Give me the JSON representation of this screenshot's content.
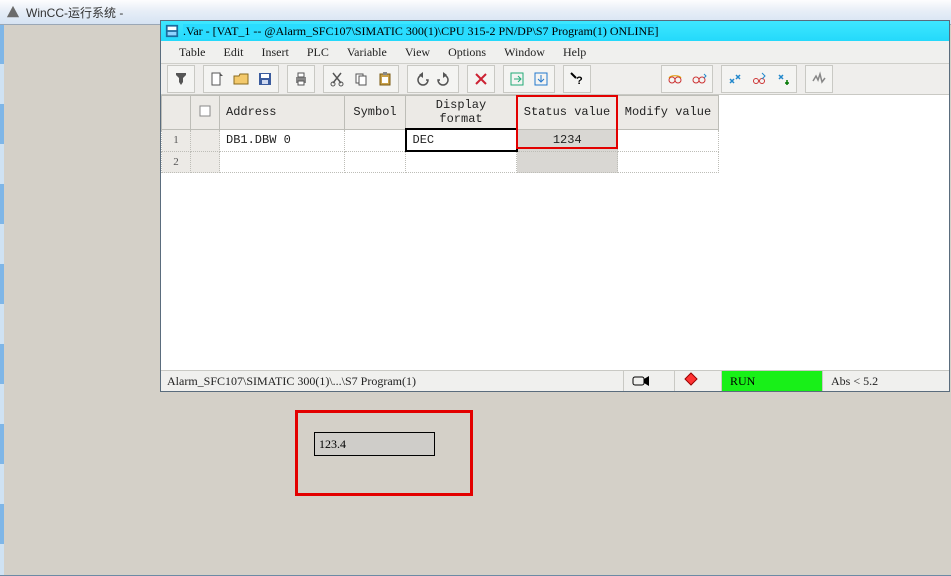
{
  "wincc": {
    "title": "WinCC-运行系统 -"
  },
  "var_window": {
    "title": ".Var - [VAT_1 -- @Alarm_SFC107\\SIMATIC 300(1)\\CPU 315-2 PN/DP\\S7 Program(1)  ONLINE]"
  },
  "menu": {
    "table": "Table",
    "edit": "Edit",
    "insert": "Insert",
    "plc": "PLC",
    "variable": "Variable",
    "view": "View",
    "options": "Options",
    "window": "Window",
    "help": "Help"
  },
  "grid": {
    "headers": {
      "address": "Address",
      "symbol": "Symbol",
      "display_format": "Display format",
      "status_value": "Status value",
      "modify_value": "Modify value"
    },
    "rows": [
      {
        "n": "1",
        "address": "DB1.DBW    0",
        "symbol": "",
        "display_format": "DEC",
        "status_value": "1234",
        "modify_value": ""
      },
      {
        "n": "2",
        "address": "",
        "symbol": "",
        "display_format": "",
        "status_value": "",
        "modify_value": ""
      }
    ]
  },
  "statusbar": {
    "path": "Alarm_SFC107\\SIMATIC 300(1)\\...\\S7 Program(1)",
    "run": "RUN",
    "abs": "Abs < 5.2"
  },
  "io_field": {
    "value": "123.4"
  }
}
